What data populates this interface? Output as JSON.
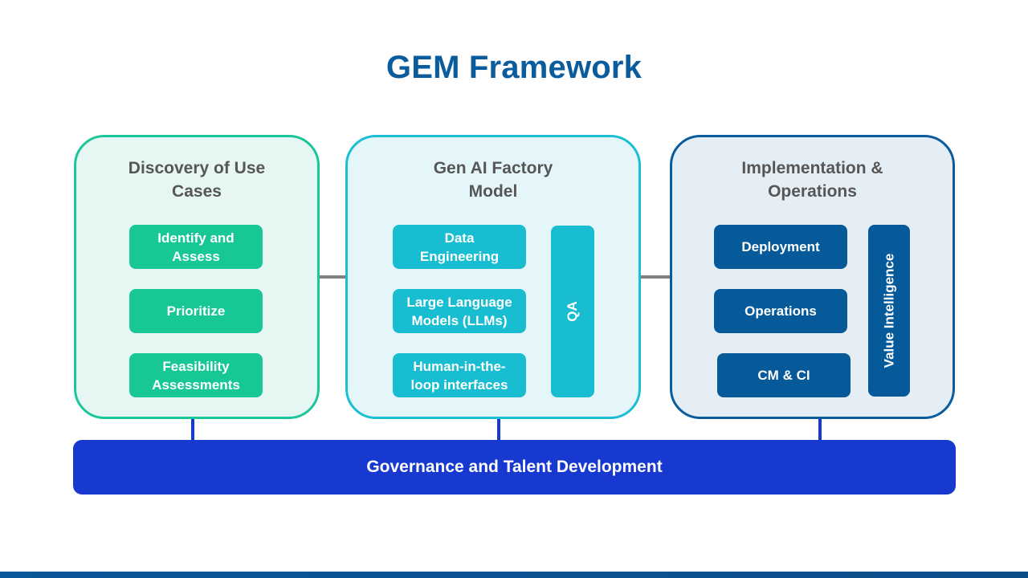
{
  "title": "GEM Framework",
  "colors": {
    "title": "#0B5C9C",
    "discovery_accent": "#1DC59A",
    "factory_accent": "#1ABFD3",
    "implementation_accent": "#0B5C9C",
    "governance_bar": "#1839CF",
    "connector_gray": "#808080"
  },
  "panels": [
    {
      "heading": "Discovery of Use Cases",
      "items": [
        "Identify and Assess",
        "Prioritize",
        "Feasibility Assessments"
      ]
    },
    {
      "heading": "Gen AI Factory Model",
      "items": [
        "Data Engineering",
        "Large Language Models (LLMs)",
        "Human-in-the-loop interfaces"
      ],
      "side_bar": "QA"
    },
    {
      "heading": "Implementation & Operations",
      "items": [
        "Deployment",
        "Operations",
        "CM & CI"
      ],
      "side_bar": "Value Intelligence"
    }
  ],
  "governance": "Governance and Talent Development"
}
